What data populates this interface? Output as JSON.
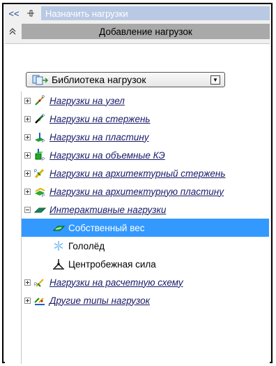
{
  "titlebar": {
    "collapse_label": "<<",
    "pin_icon": "pin-icon",
    "title": "Назначить нагрузки"
  },
  "section": {
    "chevron_icon": "double-chevron-up-icon",
    "title": "Добавление нагрузок"
  },
  "library": {
    "selected": "Библиотека нагрузок",
    "icon": "library-icon"
  },
  "tree": {
    "items": [
      {
        "label": "Нагрузки на узел",
        "expanded": false,
        "icon": "node-load-icon"
      },
      {
        "label": "Нагрузки на стержень",
        "expanded": false,
        "icon": "bar-load-icon"
      },
      {
        "label": "Нагрузки на пластину",
        "expanded": false,
        "icon": "plate-load-icon"
      },
      {
        "label": "Нагрузки на объемные КЭ",
        "expanded": false,
        "icon": "solid-load-icon"
      },
      {
        "label": "Нагрузки на архитектурный стержень",
        "expanded": false,
        "icon": "arch-bar-load-icon"
      },
      {
        "label": "Нагрузки на архитектурную пластину",
        "expanded": false,
        "icon": "arch-plate-load-icon"
      },
      {
        "label": "Интерактивные нагрузки",
        "expanded": true,
        "icon": "interactive-load-icon"
      },
      {
        "label": "Нагрузки на расчетную схему",
        "expanded": false,
        "icon": "scheme-load-icon"
      },
      {
        "label": "Другие типы нагрузок",
        "expanded": false,
        "icon": "other-load-icon"
      }
    ],
    "children": [
      {
        "label": "Собственный вес",
        "icon": "self-weight-icon",
        "selected": true
      },
      {
        "label": "Гололёд",
        "icon": "ice-icon",
        "selected": false
      },
      {
        "label": "Центробежная сила",
        "icon": "centrifugal-icon",
        "selected": false
      }
    ]
  },
  "colors": {
    "selection": "#3399ff",
    "title_bar": "#b9c9e4",
    "section_bar": "#a9a9a9"
  }
}
